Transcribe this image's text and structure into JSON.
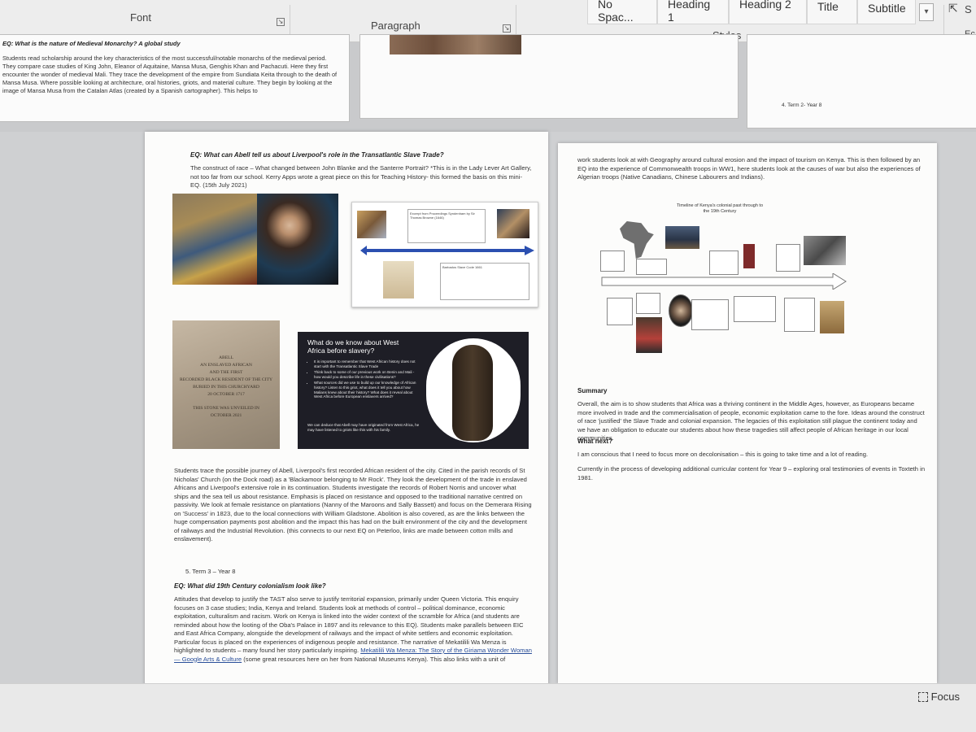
{
  "ribbon": {
    "font_label": "Font",
    "paragraph_label": "Paragraph",
    "styles_label": "Styles",
    "style_items": [
      "No Spac...",
      "Heading 1",
      "Heading 2",
      "Title",
      "Subtitle"
    ],
    "select_label": "S",
    "editing_label": "Ec"
  },
  "top_page_left": {
    "eq": "EQ: What is the nature of Medieval Monarchy? A global study",
    "body": "Students read scholarship around the key characteristics of the most successful/notable monarchs of the medieval period. They compare case studies of King John, Eleanor of Aquitaine, Mansa Musa, Genghis Khan and Pachacuti. Here they first encounter the wonder of medieval Mali. They trace the development of the empire from Sundiata Keita through to the death of Mansa Musa. Where possible looking at architecture, oral histories, griots, and material culture. They begin by looking at the image of Mansa Musa from the Catalan Atlas (created by a Spanish cartographer). This helps to"
  },
  "top_page_right": {
    "term": "4.   Term 2- Year 8"
  },
  "left_page": {
    "eq1": "EQ: What can Abell tell us about Liverpool's role in the Transatlantic Slave Trade?",
    "intro": "The construct of race – What changed between John Blanke and the Santerre Portrait? *This is in the Lady Lever Art Gallery, not too far from our school. Kerry Apps wrote a great piece on this for Teaching History- this formed the basis on this mini-EQ. (15th July 2021)",
    "timeline_slide": {
      "box1": "Excerpt from Proceedings Syndenham by Sir Thomas Browne (1646)",
      "box2": "Barbados Slave Code 1661"
    },
    "gravestone": [
      "ABELL",
      "AN ENSLAVED AFRICAN",
      "AND THE FIRST",
      "RECORDED BLACK RESIDENT OF THE CITY",
      "BURIED IN THIS CHURCHYARD",
      "20 OCTOBER 1717",
      "THIS STONE WAS UNVEILED IN",
      "OCTOBER 2021"
    ],
    "slide": {
      "title": "What do we know about West Africa before slavery?",
      "bullets": [
        "It is important to remember that West African history does not start with the Transatlantic Slave Trade",
        "Think back to some of our previous work on Benin and Mali - how would you describe life in these civilisations?",
        "What sources did we use to build up our knowledge of African history? Listen to this griot, what does it tell you about how Malians knew about their history? What does it reveal about West Africa before European enslavers arrived?"
      ],
      "conclusion": "We can deduce that Abell may have originated from West Africa, he may have listened to griots like this with his family."
    },
    "para2": "Students trace the possible journey of Abell, Liverpool's first recorded African resident of the city. Cited in the parish records of St Nicholas' Church (on the Dock road) as a 'Blackamoor belonging to Mr Rock'. They look the development of the trade in enslaved Africans and Liverpool's extensive role in its continuation. Students investigate the records of Robert Norris and uncover what ships and the sea tell us about resistance. Emphasis is placed on resistance and opposed to the traditional narrative centred on passivity. We look at female resistance on plantations (Nanny of the Maroons and Sally Bassett) and focus on the Demerara Rising on 'Success' in 1823, due to the local connections with William Gladstone. Abolition is also covered, as are the links between the huge compensation payments post abolition and the impact this has had on the built environment of the city and the development of railways and the Industrial Revolution. (this connects to our next EQ on Peterloo, links are made between cotton mills and enslavement).",
    "term": "5.   Term 3 – Year 8",
    "eq2": "EQ: What did 19th Century colonialism look like?",
    "para3": "Attitudes that develop to justify the TAST also serve to justify territorial expansion, primarily under Queen Victoria. This enquiry focuses on 3 case studies; India, Kenya and Ireland. Students look at methods of control – political dominance, economic exploitation, culturalism and racism. Work on Kenya is linked into the wider context of the scramble for Africa (and students are reminded about how the looting of the Oba's Palace in 1897 and its relevance to this EQ). Students make parallels between EIC and East Africa Company, alongside the development of railways and the impact of white settlers and economic exploitation. Particular focus is placed on the experiences of indigenous people and resistance. The narrative of Mekatilili Wa Menza is highlighted to students – many found her story particularly inspiring.",
    "link": "Mekatilili Wa Menza: The Story of the Giriama Wonder Woman — Google Arts & Culture",
    "para3_end": "(some great resources here on her from National Museums Kenya). This also links with a unit of"
  },
  "right_page": {
    "intro": "work students look at with Geography around cultural erosion and the impact of tourism on Kenya. This is then followed by an EQ into the experience of Commonwealth troops in WW1, here students look at the causes of war but also the experiences of Algerian troops (Native Canadians, Chinese Labourers and Indians).",
    "timeline_title": "Timeline of Kenya's colonial past through to the 19th Century",
    "summary_heading": "Summary",
    "summary": "Overall, the aim is to show students that Africa was a thriving continent in the Middle Ages, however, as Europeans became more involved in trade and the commercialisation of people, economic exploitation came to the fore. Ideas around the construct of race 'justified' the Slave Trade and colonial expansion. The legacies of this exploitation still plague the continent today and we have an obligation to educate our students about how these tragedies still affect people of African heritage in our local communities.",
    "next_heading": "What next?",
    "next1": "I am conscious that I need to focus more on decolonisation – this is going to take time and a lot of reading.",
    "next2": "Currently in the process of developing additional curricular content for Year 9 – exploring oral testimonies of events in Toxteth in 1981."
  },
  "status": {
    "focus_label": "Focus"
  },
  "colors": {
    "slide_bg": "#1e1e26",
    "arrow_blue": "#2b4fb0"
  }
}
